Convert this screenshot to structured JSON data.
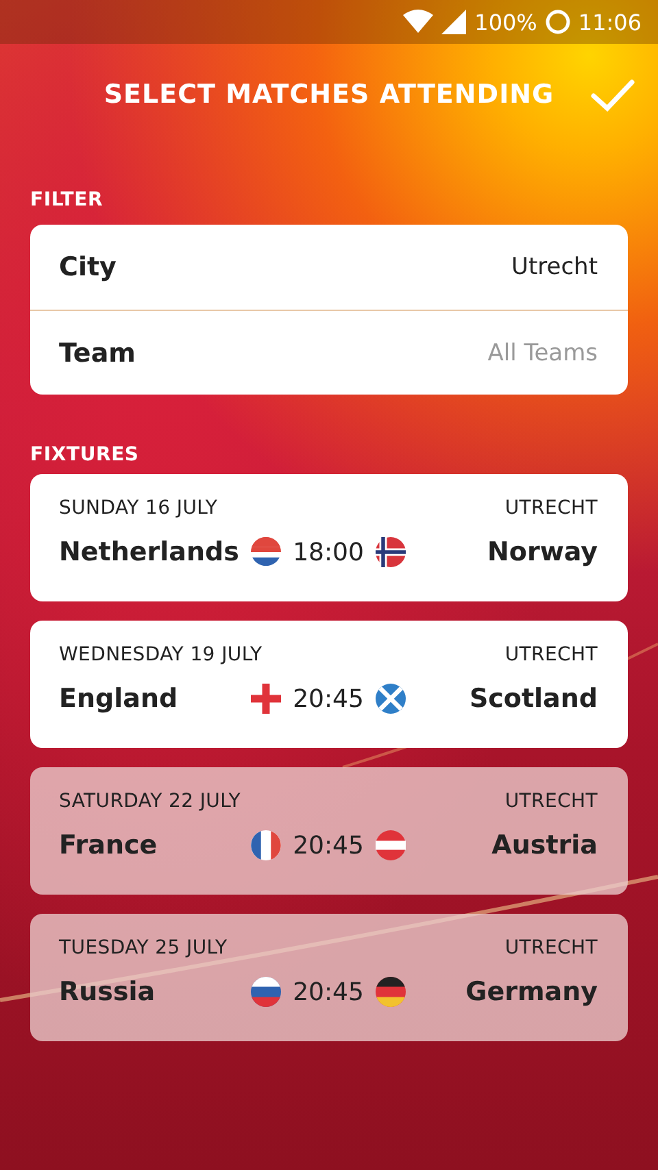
{
  "status_bar": {
    "battery": "100%",
    "time": "11:06"
  },
  "header": {
    "title": "SELECT MATCHES ATTENDING"
  },
  "filter": {
    "heading": "FILTER",
    "rows": [
      {
        "label": "City",
        "value": "Utrecht"
      },
      {
        "label": "Team",
        "placeholder": "All Teams"
      }
    ]
  },
  "fixtures": {
    "heading": "FIXTURES",
    "items": [
      {
        "date": "SUNDAY 16 JULY",
        "city": "UTRECHT",
        "home": "Netherlands",
        "time": "18:00",
        "away": "Norway",
        "selected": true
      },
      {
        "date": "WEDNESDAY 19 JULY",
        "city": "UTRECHT",
        "home": "England",
        "time": "20:45",
        "away": "Scotland",
        "selected": true
      },
      {
        "date": "SATURDAY 22 JULY",
        "city": "UTRECHT",
        "home": "France",
        "time": "20:45",
        "away": "Austria",
        "selected": false
      },
      {
        "date": "TUESDAY 25 JULY",
        "city": "UTRECHT",
        "home": "Russia",
        "time": "20:45",
        "away": "Germany",
        "selected": false
      }
    ]
  }
}
